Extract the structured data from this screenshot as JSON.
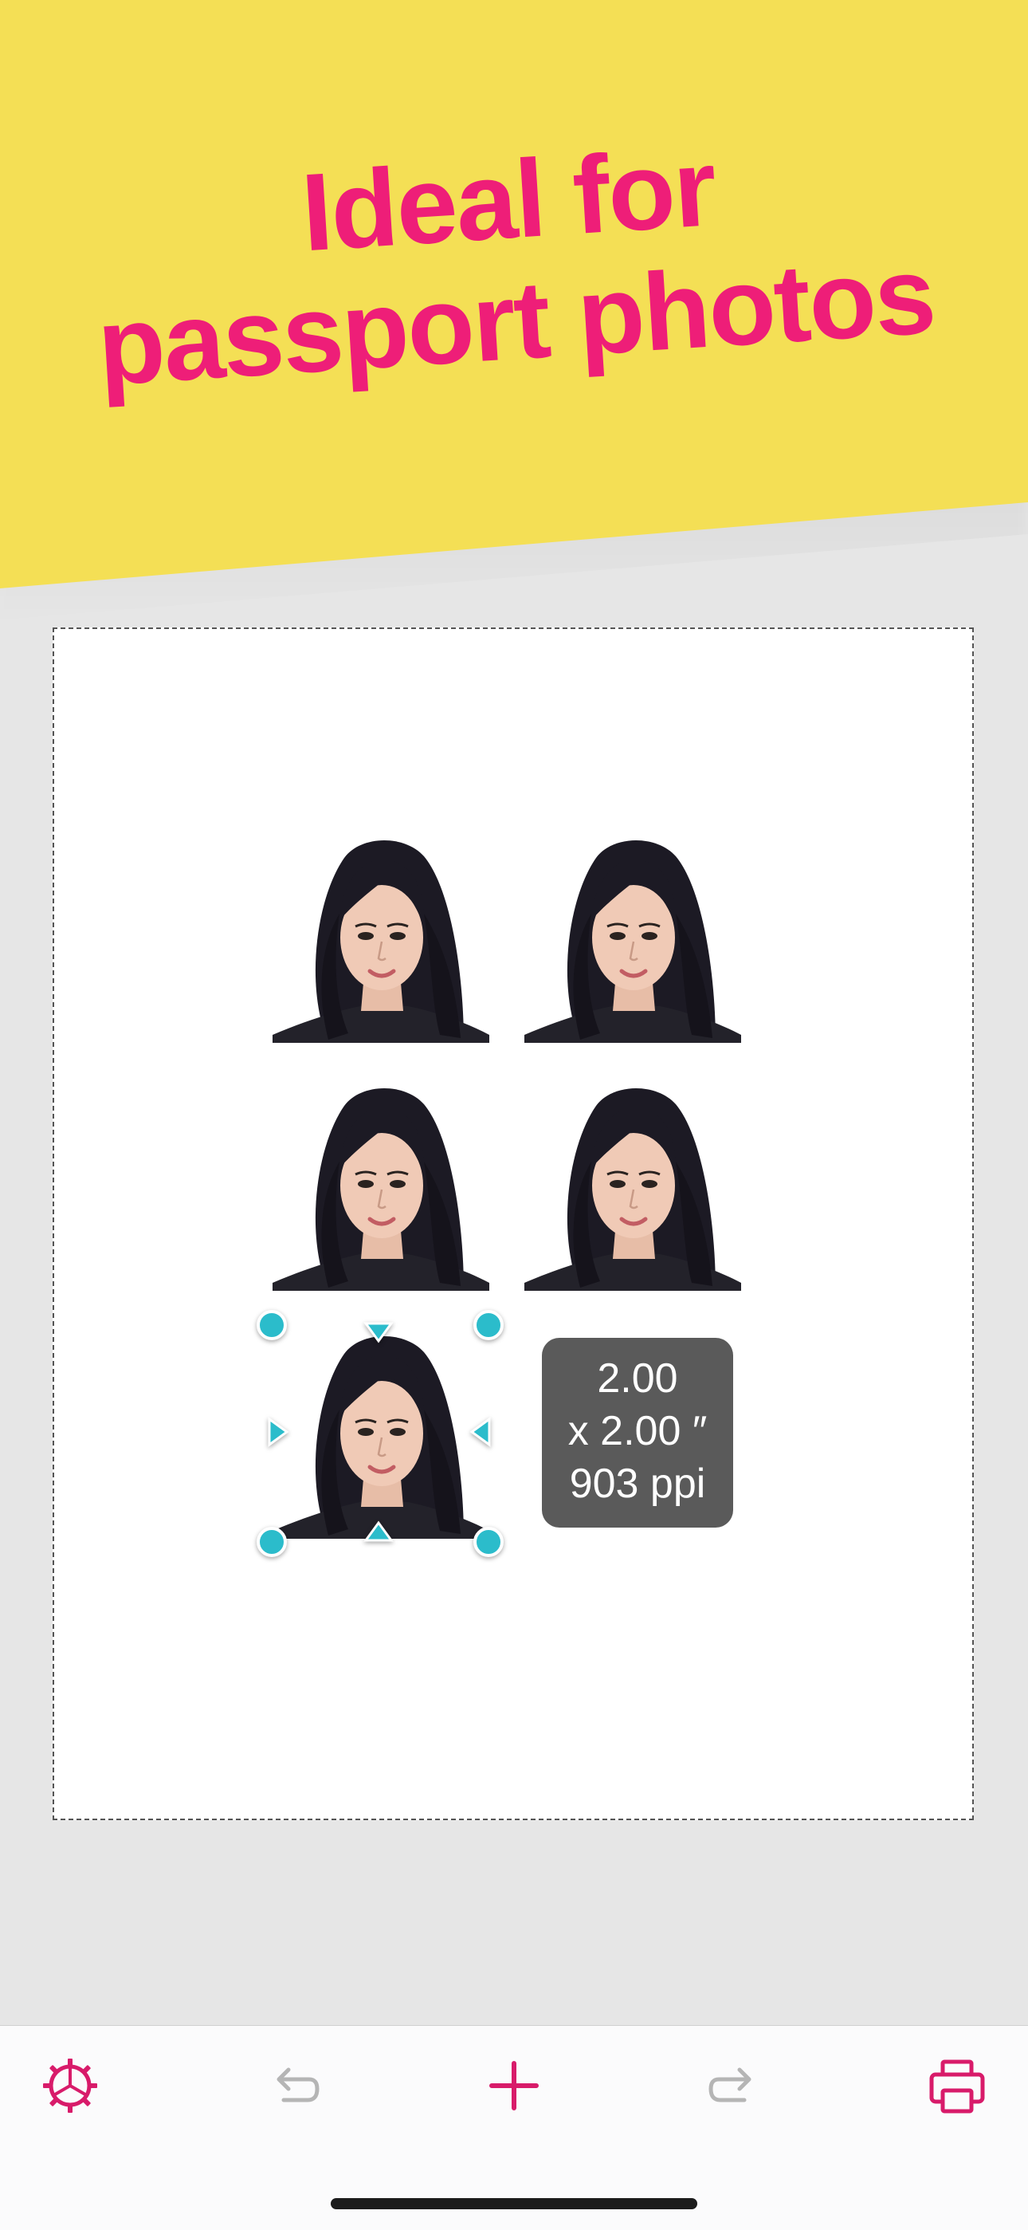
{
  "banner": {
    "headline_line1": "Ideal for",
    "headline_line2": "passport photos",
    "background": "#f4df55",
    "text_color": "#ee1e78"
  },
  "canvas": {
    "photo_count": 5,
    "selected_photo": 5
  },
  "size_badge": {
    "line1": "2.00",
    "line2": "x 2.00 ″",
    "line3": "903 ppi"
  },
  "toolbar": {
    "items": [
      {
        "icon": "settings-gear-icon",
        "color": "#d81b6a"
      },
      {
        "icon": "undo-icon",
        "color": "#b5b5b5"
      },
      {
        "icon": "add-icon",
        "color": "#d81b6a"
      },
      {
        "icon": "redo-icon",
        "color": "#b5b5b5"
      },
      {
        "icon": "print-icon",
        "color": "#d81b6a"
      }
    ]
  },
  "colors": {
    "accent": "#d81b6a",
    "handle": "#2bbccb",
    "badge": "#5a5a5a"
  }
}
